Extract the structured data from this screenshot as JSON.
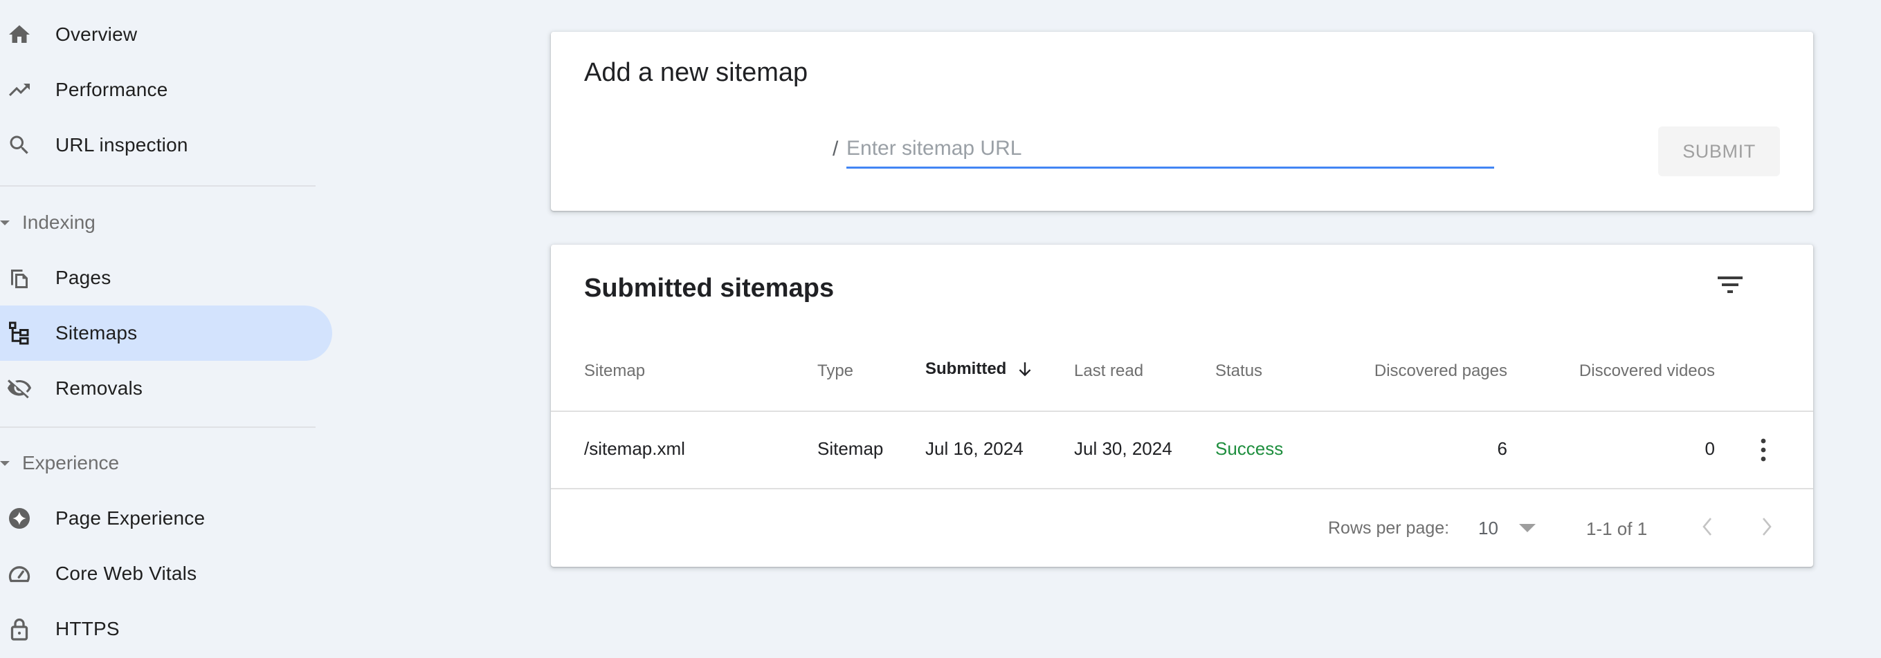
{
  "sidebar": {
    "items_top": [
      {
        "label": "Overview",
        "icon": "home-icon"
      },
      {
        "label": "Performance",
        "icon": "trending-up-icon"
      },
      {
        "label": "URL inspection",
        "icon": "search-icon"
      }
    ],
    "sections": [
      {
        "label": "Indexing",
        "expanded": true,
        "items": [
          {
            "label": "Pages",
            "icon": "pages-copy-icon",
            "active": false
          },
          {
            "label": "Sitemaps",
            "icon": "sitemap-tree-icon",
            "active": true
          },
          {
            "label": "Removals",
            "icon": "visibility-off-icon",
            "active": false
          }
        ]
      },
      {
        "label": "Experience",
        "expanded": true,
        "items": [
          {
            "label": "Page Experience",
            "icon": "sparkle-circle-icon",
            "active": false
          },
          {
            "label": "Core Web Vitals",
            "icon": "speed-gauge-icon",
            "active": false
          },
          {
            "label": "HTTPS",
            "icon": "lock-icon",
            "active": false
          }
        ]
      }
    ]
  },
  "add_sitemap": {
    "title": "Add a new sitemap",
    "url_prefix": "/",
    "input_value": "",
    "input_placeholder": "Enter sitemap URL",
    "submit_label": "SUBMIT",
    "submit_enabled": false
  },
  "submitted": {
    "title": "Submitted sitemaps",
    "filter_icon": "filter-list-icon",
    "columns": {
      "sitemap": "Sitemap",
      "type": "Type",
      "submitted": "Submitted",
      "last_read": "Last read",
      "status": "Status",
      "discovered_pages": "Discovered pages",
      "discovered_videos": "Discovered videos"
    },
    "sort": {
      "column": "submitted",
      "direction": "descending"
    },
    "rows": [
      {
        "sitemap": "/sitemap.xml",
        "type": "Sitemap",
        "submitted": "Jul 16, 2024",
        "last_read": "Jul 30, 2024",
        "status": "Success",
        "discovered_pages": "6",
        "discovered_videos": "0"
      }
    ],
    "pagination": {
      "rows_per_page_label": "Rows per page:",
      "rows_per_page": "10",
      "range": "1-1 of 1"
    }
  },
  "colors": {
    "background": "#eff3f8",
    "active_nav": "#d3e3fd",
    "input_underline": "#4285f4",
    "status_success": "#1e8e3e"
  }
}
